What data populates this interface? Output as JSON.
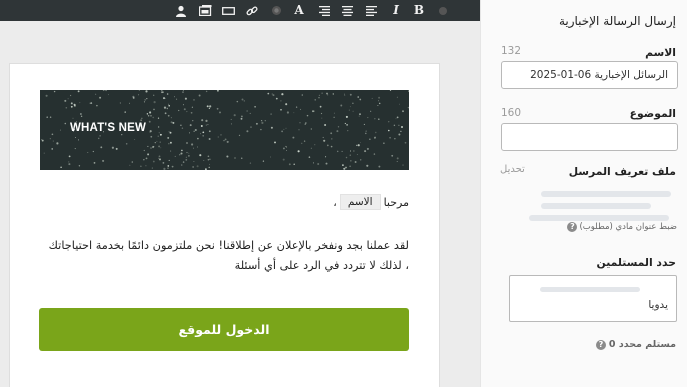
{
  "toolbar": {
    "buttons": [
      {
        "name": "user-icon",
        "glyph": ""
      },
      {
        "name": "image-icon",
        "glyph": ""
      },
      {
        "name": "button-block-icon",
        "glyph": ""
      },
      {
        "name": "link-icon",
        "glyph": ""
      },
      {
        "name": "color-icon",
        "glyph": ""
      },
      {
        "name": "font-icon",
        "glyph": "A"
      },
      {
        "name": "align-right-icon",
        "glyph": ""
      },
      {
        "name": "align-center-icon",
        "glyph": ""
      },
      {
        "name": "align-left-icon",
        "glyph": ""
      },
      {
        "name": "italic-icon",
        "glyph": "I"
      },
      {
        "name": "bold-icon",
        "glyph": "B"
      },
      {
        "name": "more-icon",
        "glyph": ""
      }
    ]
  },
  "email": {
    "banner_text": "WHAT'S NEW",
    "greeting": "مرحبا",
    "name_tag": "الاسم",
    "greeting_suffix": "،",
    "body_line1": "لقد عملنا بجد ونفخر بالإعلان عن إطلاقنا! نحن ملتزمون دائمًا بخدمة احتياجاتك",
    "body_line2": "، لذلك لا تتردد في الرد على أي أسئلة",
    "cta_label": "الدخول للموقع"
  },
  "panel": {
    "title": "إرسال الرسالة الإخبارية",
    "name_label": "الاسم",
    "name_counter": "132",
    "name_value": "2025-01-06 الرسائل الإخبارية",
    "subject_label": "الموضوع",
    "subject_counter": "160",
    "subject_value": "",
    "sender_label": "ملف تعريف المرسل",
    "edit_link": "تحديل",
    "sender_hint": "ضبط عنوان مادي (مطلوب)",
    "recipients_label": "حدد المستلمين",
    "recipients_chip": "يدويا",
    "recipient_count": "مستلم محدد 0"
  },
  "colors": {
    "toolbar_bg": "#2f3537",
    "cta_green": "#7aa51a",
    "banner_bg": "#263030"
  }
}
